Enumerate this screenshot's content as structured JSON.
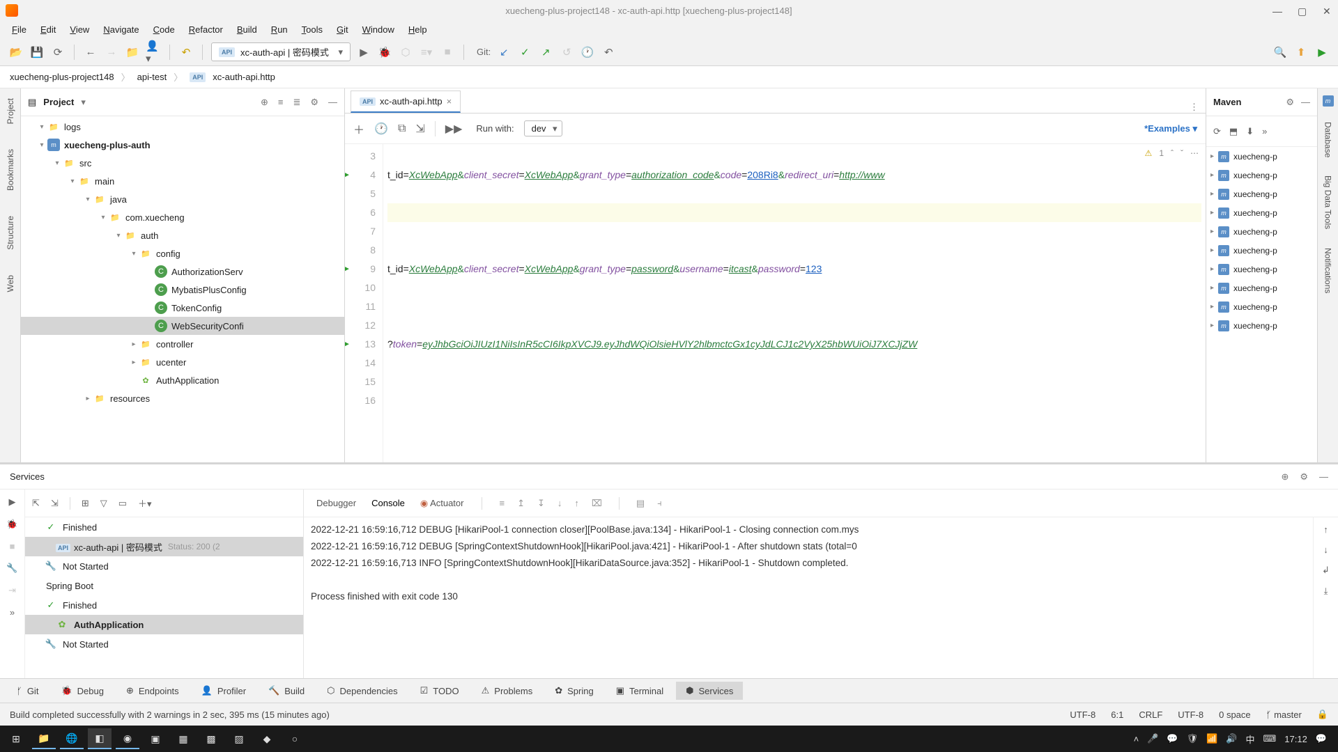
{
  "window": {
    "title": "xuecheng-plus-project148 - xc-auth-api.http [xuecheng-plus-project148]"
  },
  "menu": [
    "File",
    "Edit",
    "View",
    "Navigate",
    "Code",
    "Refactor",
    "Build",
    "Run",
    "Tools",
    "Git",
    "Window",
    "Help"
  ],
  "toolbar": {
    "run_combo": "xc-auth-api | 密码模式",
    "git_label": "Git:"
  },
  "breadcrumb": {
    "root": "xuecheng-plus-project148",
    "mid": "api-test",
    "file": "xc-auth-api.http"
  },
  "project": {
    "title": "Project",
    "tree": [
      {
        "indent": 1,
        "arrow": "▾",
        "icon": "folder",
        "label": "logs"
      },
      {
        "indent": 1,
        "arrow": "▾",
        "icon": "module",
        "label": "xuecheng-plus-auth",
        "bold": true
      },
      {
        "indent": 2,
        "arrow": "▾",
        "icon": "folder",
        "label": "src"
      },
      {
        "indent": 3,
        "arrow": "▾",
        "icon": "folder",
        "label": "main"
      },
      {
        "indent": 4,
        "arrow": "▾",
        "icon": "folder",
        "label": "java"
      },
      {
        "indent": 5,
        "arrow": "▾",
        "icon": "folder",
        "label": "com.xuecheng"
      },
      {
        "indent": 6,
        "arrow": "▾",
        "icon": "folder",
        "label": "auth"
      },
      {
        "indent": 7,
        "arrow": "▾",
        "icon": "folder",
        "label": "config"
      },
      {
        "indent": 8,
        "arrow": "",
        "icon": "class",
        "label": "AuthorizationServ"
      },
      {
        "indent": 8,
        "arrow": "",
        "icon": "class",
        "label": "MybatisPlusConfig"
      },
      {
        "indent": 8,
        "arrow": "",
        "icon": "class",
        "label": "TokenConfig"
      },
      {
        "indent": 8,
        "arrow": "",
        "icon": "class",
        "label": "WebSecurityConfi",
        "sel": true
      },
      {
        "indent": 7,
        "arrow": "▸",
        "icon": "folder",
        "label": "controller"
      },
      {
        "indent": 7,
        "arrow": "▸",
        "icon": "folder",
        "label": "ucenter"
      },
      {
        "indent": 7,
        "arrow": "",
        "icon": "spring",
        "label": "AuthApplication"
      },
      {
        "indent": 4,
        "arrow": "▸",
        "icon": "folder",
        "label": "resources"
      }
    ]
  },
  "editor": {
    "tab": "xc-auth-api.http",
    "runwith": "Run with:",
    "env": "dev",
    "examples": "Examples",
    "warn_count": "1",
    "gutter_start": 3,
    "lines": [
      {
        "n": 3,
        "html": ""
      },
      {
        "n": 4,
        "run": true,
        "html": "t_id=<span class='tok-val'>XcWebApp</span><span class='tok-amp'>&amp;</span><span class='tok-param'>client_secret</span>=<span class='tok-val'>XcWebApp</span><span class='tok-amp'>&amp;</span><span class='tok-param'>grant_type</span>=<span class='tok-val'>authorization_code</span><span class='tok-amp'>&amp;</span><span class='tok-param'>code</span>=<span class='tok-num'>208Ri8</span><span class='tok-amp'>&amp;</span><span class='tok-param'>redirect_uri</span>=<span class='tok-val'>http://www</span>"
      },
      {
        "n": 5,
        "html": ""
      },
      {
        "n": 6,
        "hl": true,
        "html": ""
      },
      {
        "n": 7,
        "html": ""
      },
      {
        "n": 8,
        "html": ""
      },
      {
        "n": 9,
        "run": true,
        "html": "t_id=<span class='tok-val'>XcWebApp</span><span class='tok-amp'>&amp;</span><span class='tok-param'>client_secret</span>=<span class='tok-val'>XcWebApp</span><span class='tok-amp'>&amp;</span><span class='tok-param'>grant_type</span>=<span class='tok-val'>password</span><span class='tok-amp'>&amp;</span><span class='tok-param'>username</span>=<span class='tok-val'>itcast</span><span class='tok-amp'>&amp;</span><span class='tok-param'>password</span>=<span class='tok-num'>123</span>"
      },
      {
        "n": 10,
        "html": ""
      },
      {
        "n": 11,
        "html": ""
      },
      {
        "n": 12,
        "html": ""
      },
      {
        "n": 13,
        "run": true,
        "html": "?<span class='tok-param'>token</span>=<span class='tok-val'>eyJhbGciOiJIUzI1NiIsInR5cCI6IkpXVCJ9.eyJhdWQiOlsieHVlY2hlbmctcGx1cyJdLCJ1c2VyX25hbWUiOiJ7XCJjZW</span>"
      },
      {
        "n": 14,
        "html": ""
      },
      {
        "n": 15,
        "html": ""
      },
      {
        "n": 16,
        "html": ""
      }
    ]
  },
  "maven": {
    "title": "Maven",
    "nodes": [
      "xuecheng-p",
      "xuecheng-p",
      "xuecheng-p",
      "xuecheng-p",
      "xuecheng-p",
      "xuecheng-p",
      "xuecheng-p",
      "xuecheng-p",
      "xuecheng-p",
      "xuecheng-p"
    ]
  },
  "services": {
    "title": "Services",
    "tree": [
      {
        "icon": "ok",
        "label": "Finished"
      },
      {
        "icon": "api",
        "label": "xc-auth-api | 密码模式",
        "status": "Status: 200 (2",
        "sel": true
      },
      {
        "icon": "wrench",
        "label": "Not Started"
      },
      {
        "icon": "",
        "label": "Spring Boot",
        "head": true
      },
      {
        "icon": "ok",
        "label": "Finished"
      },
      {
        "icon": "spring",
        "label": "AuthApplication",
        "bold": true,
        "sel": true
      },
      {
        "icon": "wrench",
        "label": "Not Started"
      }
    ],
    "console_tabs": {
      "debugger": "Debugger",
      "console": "Console",
      "actuator": "Actuator"
    },
    "console_lines": [
      "2022-12-21 16:59:16,712 DEBUG [HikariPool-1 connection closer][PoolBase.java:134] - HikariPool-1 - Closing connection com.mys",
      "2022-12-21 16:59:16,712 DEBUG [SpringContextShutdownHook][HikariPool.java:421] - HikariPool-1 - After shutdown stats (total=0",
      "2022-12-21 16:59:16,713 INFO [SpringContextShutdownHook][HikariDataSource.java:352] - HikariPool-1 - Shutdown completed.",
      "",
      "Process finished with exit code 130"
    ]
  },
  "bottom_tabs": [
    {
      "label": "Git"
    },
    {
      "label": "Debug"
    },
    {
      "label": "Endpoints"
    },
    {
      "label": "Profiler"
    },
    {
      "label": "Build"
    },
    {
      "label": "Dependencies"
    },
    {
      "label": "TODO"
    },
    {
      "label": "Problems"
    },
    {
      "label": "Spring"
    },
    {
      "label": "Terminal"
    },
    {
      "label": "Services",
      "act": true
    }
  ],
  "status": {
    "msg": "Build completed successfully with 2 warnings in 2 sec, 395 ms (15 minutes ago)",
    "enc": "UTF-8",
    "pos": "6:1",
    "eol": "CRLF",
    "enc2": "UTF-8",
    "indent": "0 space",
    "branch": "master"
  },
  "taskbar": {
    "time": "17:12"
  },
  "rightstrip": [
    "Database",
    "Big Data Tools",
    "Notifications"
  ]
}
